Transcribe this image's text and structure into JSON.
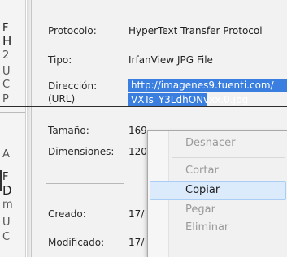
{
  "background_window": {
    "fragments": [
      "F",
      "H",
      "2",
      "U",
      "C",
      "P",
      "A",
      "F",
      "D",
      "m",
      "U",
      "C"
    ]
  },
  "properties": {
    "protocol_label": "Protocolo:",
    "protocol_value": "HyperText Transfer Protocol",
    "type_label": "Tipo:",
    "type_value": "IrfanView JPG File",
    "address_label_line1": "Dirección:",
    "address_label_line2": "(URL)",
    "address_line1": "http://imagenes9.tuenti.com/",
    "address_line2": "VXTs_Y3LdhONvxx.0.jpg",
    "size_label": "Tamaño:",
    "size_value": "169",
    "dimensions_label": "Dimensiones:",
    "dimensions_value": "120",
    "created_label": "Creado:",
    "created_value": "17/",
    "modified_label": "Modificado:",
    "modified_value": "17/"
  },
  "context_menu": {
    "undo": "Deshacer",
    "cut": "Cortar",
    "copy": "Copiar",
    "paste": "Pegar",
    "delete": "Eliminar"
  },
  "colors": {
    "selection": "#3a7fe0",
    "menu_highlight": "#dcebfc",
    "menu_highlight_border": "#a9cdf5"
  }
}
